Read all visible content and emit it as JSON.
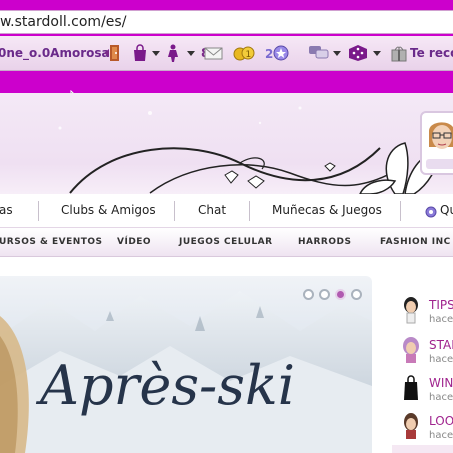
{
  "browser": {
    "url": "w.stardoll.com/es/"
  },
  "toolbar": {
    "username": "0ne_o.0Amorosa",
    "message_count": "8",
    "starcoins_icon": "starcoins-icon",
    "stardollars_icon": "stardollars-icon",
    "promo_text": "Te reco"
  },
  "nav": {
    "main": [
      {
        "label": "as"
      },
      {
        "label": "Clubs & Amigos"
      },
      {
        "label": "Chat"
      },
      {
        "label": "Muñecas & Juegos"
      },
      {
        "label": "Qu"
      }
    ],
    "sub": [
      {
        "label": "URSOS & EVENTOS"
      },
      {
        "label": "VÍDEO"
      },
      {
        "label": "JUEGOS CELULAR"
      },
      {
        "label": "HARRODS"
      },
      {
        "label": "FASHION INC"
      }
    ]
  },
  "hero": {
    "title": "Après-ski",
    "slides_total": 4,
    "active_slide": 3
  },
  "news": [
    {
      "title": "TIPS",
      "sub": "hace"
    },
    {
      "title": "STAR",
      "sub": "hace"
    },
    {
      "title": "WINT",
      "sub": "hace"
    },
    {
      "title": "LOO",
      "sub": "hace"
    }
  ],
  "colors": {
    "brand_magenta": "#cc00cc",
    "link_purple": "#a0248e"
  }
}
